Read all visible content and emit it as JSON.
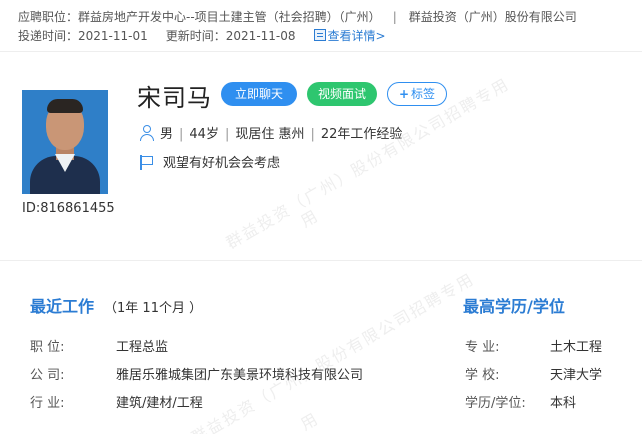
{
  "header": {
    "position_label": "应聘职位：",
    "position_value": "群益房地产开发中心--项目土建主管（社会招聘）（广州）",
    "separator": "|",
    "company": "群益投资（广州）股份有限公司",
    "submit_label": "投递时间：",
    "submit_date": "2021-11-01",
    "update_label": "更新时间：",
    "update_date": "2021-11-08",
    "detail_link": "查看详情>"
  },
  "candidate": {
    "name": "宋司马",
    "id_text": "ID:816861455",
    "gender": "男",
    "age": "44岁",
    "residence": "现居住 惠州",
    "experience": "22年工作经验",
    "intent": "观望有好机会会考虑",
    "divider": "|"
  },
  "actions": {
    "chat": "立即聊天",
    "video": "视频面试",
    "tag": "标签",
    "tag_plus": "+"
  },
  "work": {
    "title": "最近工作",
    "duration": "（1年 11个月 ）",
    "rows": [
      {
        "label": "职    位:",
        "value": "工程总监"
      },
      {
        "label": "公    司:",
        "value": "雅居乐雅城集团广东美景环境科技有限公司"
      },
      {
        "label": "行    业:",
        "value": "建筑/建材/工程"
      }
    ]
  },
  "education": {
    "title": "最高学历/学位",
    "rows": [
      {
        "label": "专    业:",
        "value": "土木工程"
      },
      {
        "label": "学    校:",
        "value": "天津大学"
      },
      {
        "label": "学历/学位:",
        "value": "本科"
      }
    ]
  },
  "watermark": {
    "line_a": "群益投资（广州）股份有限公司招聘专用",
    "line_b": "用"
  },
  "colors": {
    "accent": "#2b7cd3",
    "chat_button": "#2f8ff0",
    "video_button": "#2ec66f"
  }
}
